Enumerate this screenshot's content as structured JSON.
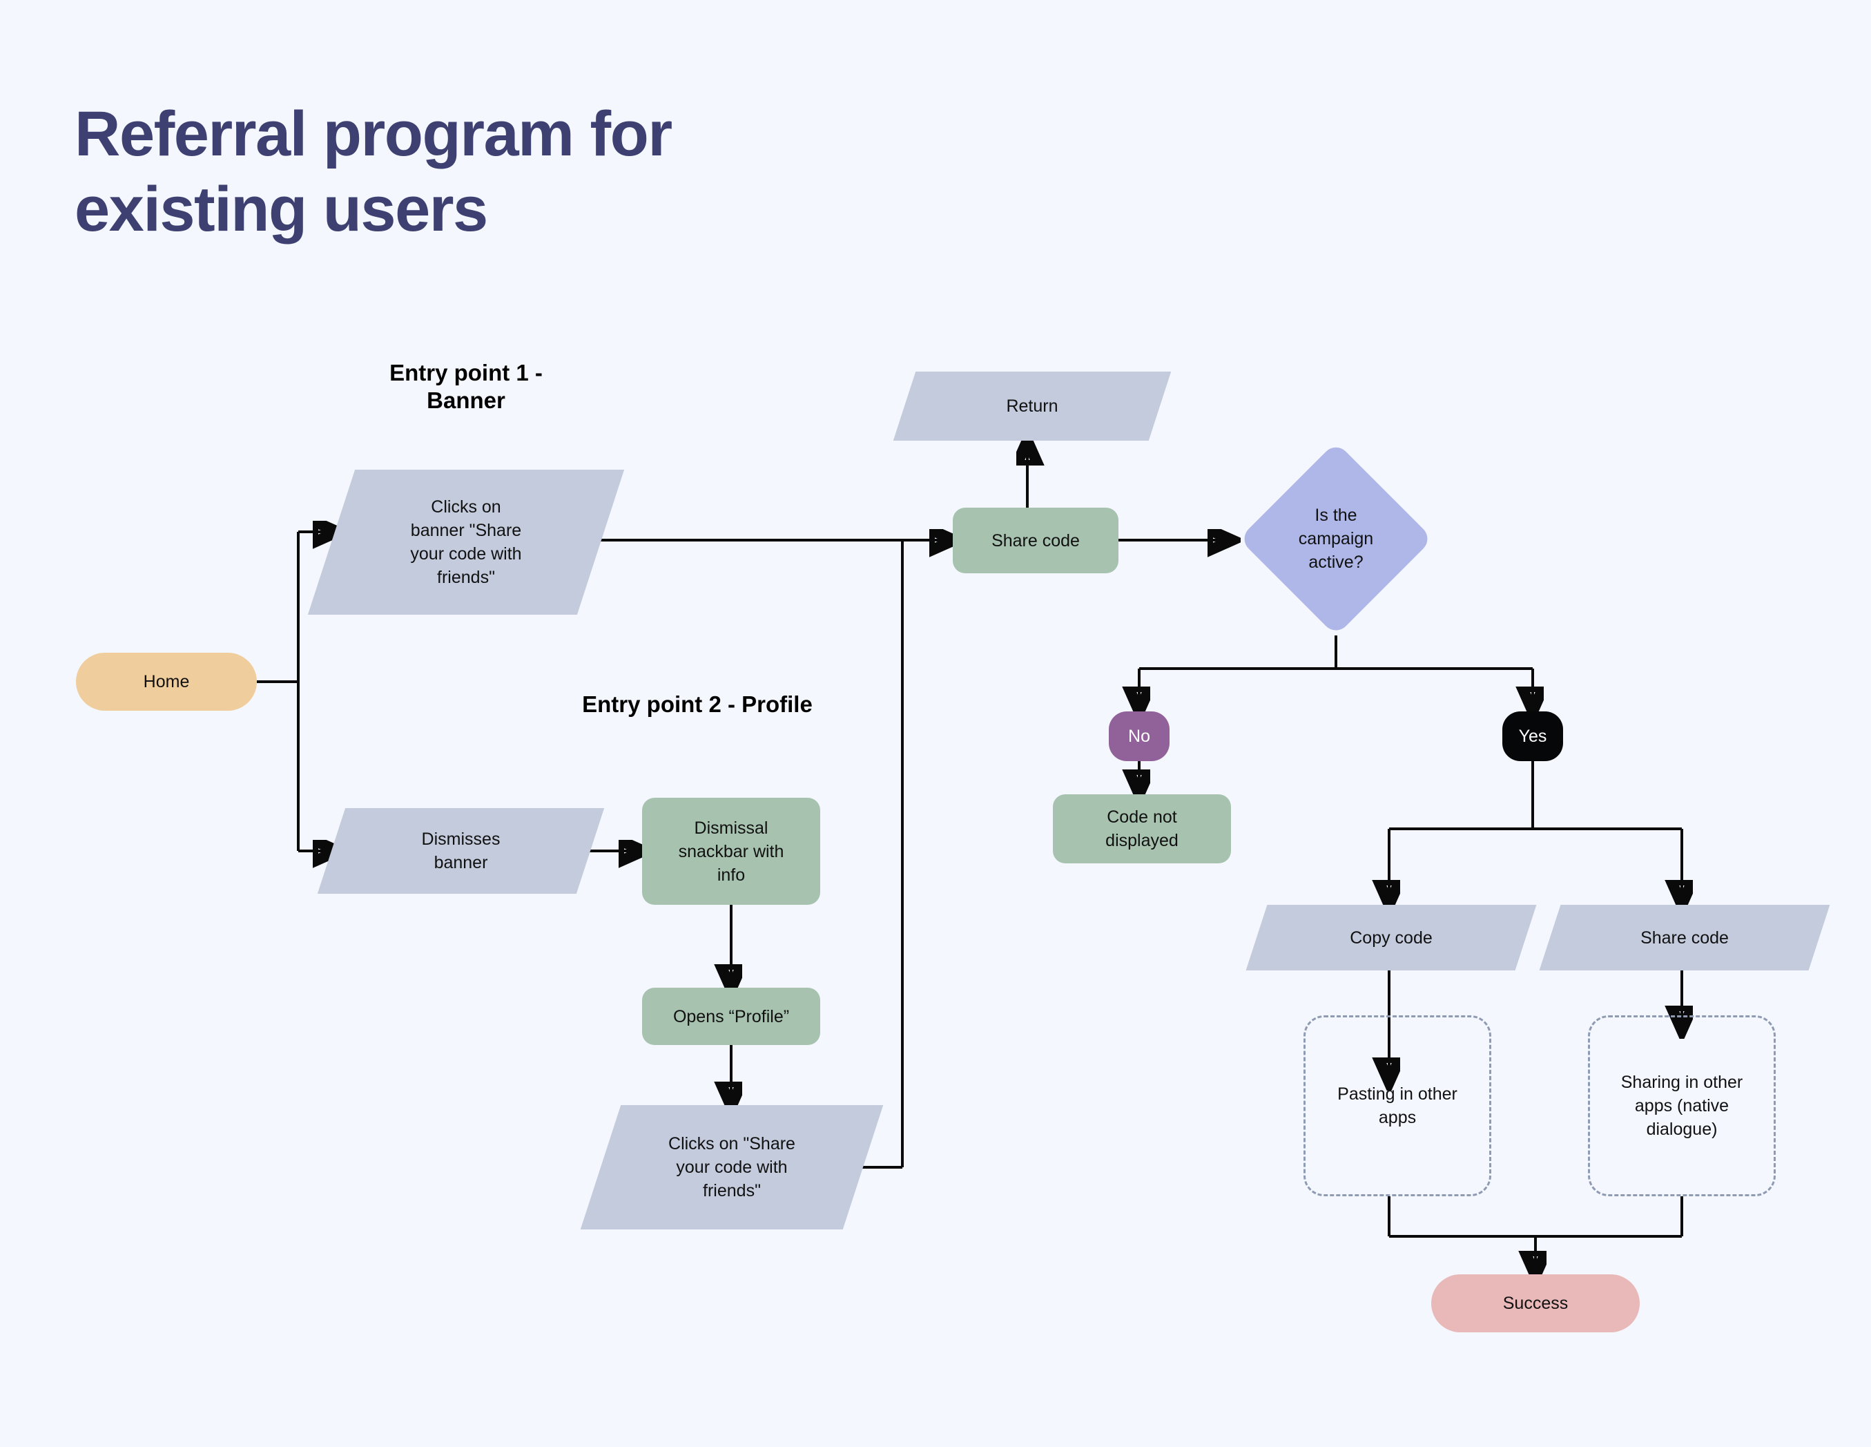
{
  "page": {
    "title": "Referral program for existing users",
    "background_color": "#f4f7fd",
    "title_color": "#3d4070"
  },
  "headings": {
    "entry_point_1": "Entry point 1\n- Banner",
    "entry_point_2": "Entry point 2 -\nProfile"
  },
  "nodes": {
    "home": {
      "label": "Home",
      "shape": "pill",
      "color": "#efcd9d"
    },
    "clicks_banner": {
      "label": "Clicks on\nbanner \"Share\nyour code with\nfriends\"",
      "shape": "parallelogram",
      "color": "#c3cbdd"
    },
    "dismisses_banner": {
      "label": "Dismisses\nbanner",
      "shape": "parallelogram",
      "color": "#c3cbdd"
    },
    "dismissal_snackbar": {
      "label": "Dismissal\nsnackbar with\ninfo",
      "shape": "process",
      "color": "#a7c3b0"
    },
    "opens_profile": {
      "label": "Opens “Profile”",
      "shape": "process",
      "color": "#a7c3b0"
    },
    "clicks_share_profile": {
      "label": "Clicks on \"Share\nyour code with\nfriends\"",
      "shape": "parallelogram",
      "color": "#c3cbdd"
    },
    "return": {
      "label": "Return",
      "shape": "parallelogram",
      "color": "#c3cbdd"
    },
    "share_code_main": {
      "label": "Share code",
      "shape": "process",
      "color": "#a7c3b0"
    },
    "campaign_active": {
      "label": "Is the\ncampaign\nactive?",
      "shape": "diamond",
      "color": "#aeb7e8"
    },
    "badge_no": {
      "label": "No",
      "shape": "badge",
      "color": "#91629a"
    },
    "badge_yes": {
      "label": "Yes",
      "shape": "badge",
      "color": "#060708"
    },
    "code_not_displayed": {
      "label": "Code not\ndisplayed",
      "shape": "process",
      "color": "#a7c3b0"
    },
    "copy_code": {
      "label": "Copy code",
      "shape": "parallelogram",
      "color": "#c3cbdd"
    },
    "share_code_branch": {
      "label": "Share code",
      "shape": "parallelogram",
      "color": "#c3cbdd"
    },
    "pasting_other_apps": {
      "label": "Pasting in other\napps",
      "shape": "dashed-container"
    },
    "sharing_other_apps": {
      "label": "Sharing in other\napps (native\ndialogue)",
      "shape": "dashed-container"
    },
    "success": {
      "label": "Success",
      "shape": "pill",
      "color": "#e9b9ba"
    }
  },
  "flow": {
    "type": "flowchart",
    "edges": [
      {
        "from": "home",
        "to": "clicks_banner"
      },
      {
        "from": "home",
        "to": "dismisses_banner"
      },
      {
        "from": "clicks_banner",
        "to": "share_code_main"
      },
      {
        "from": "dismisses_banner",
        "to": "dismissal_snackbar"
      },
      {
        "from": "dismissal_snackbar",
        "to": "opens_profile"
      },
      {
        "from": "opens_profile",
        "to": "clicks_share_profile"
      },
      {
        "from": "clicks_share_profile",
        "to": "share_code_main"
      },
      {
        "from": "share_code_main",
        "to": "return"
      },
      {
        "from": "share_code_main",
        "to": "campaign_active"
      },
      {
        "from": "campaign_active",
        "to": "badge_no",
        "label": "No"
      },
      {
        "from": "campaign_active",
        "to": "badge_yes",
        "label": "Yes"
      },
      {
        "from": "badge_no",
        "to": "code_not_displayed"
      },
      {
        "from": "badge_yes",
        "to": "copy_code"
      },
      {
        "from": "badge_yes",
        "to": "share_code_branch"
      },
      {
        "from": "copy_code",
        "to": "pasting_other_apps"
      },
      {
        "from": "share_code_branch",
        "to": "sharing_other_apps"
      },
      {
        "from": "pasting_other_apps",
        "to": "success"
      },
      {
        "from": "sharing_other_apps",
        "to": "success"
      }
    ]
  }
}
